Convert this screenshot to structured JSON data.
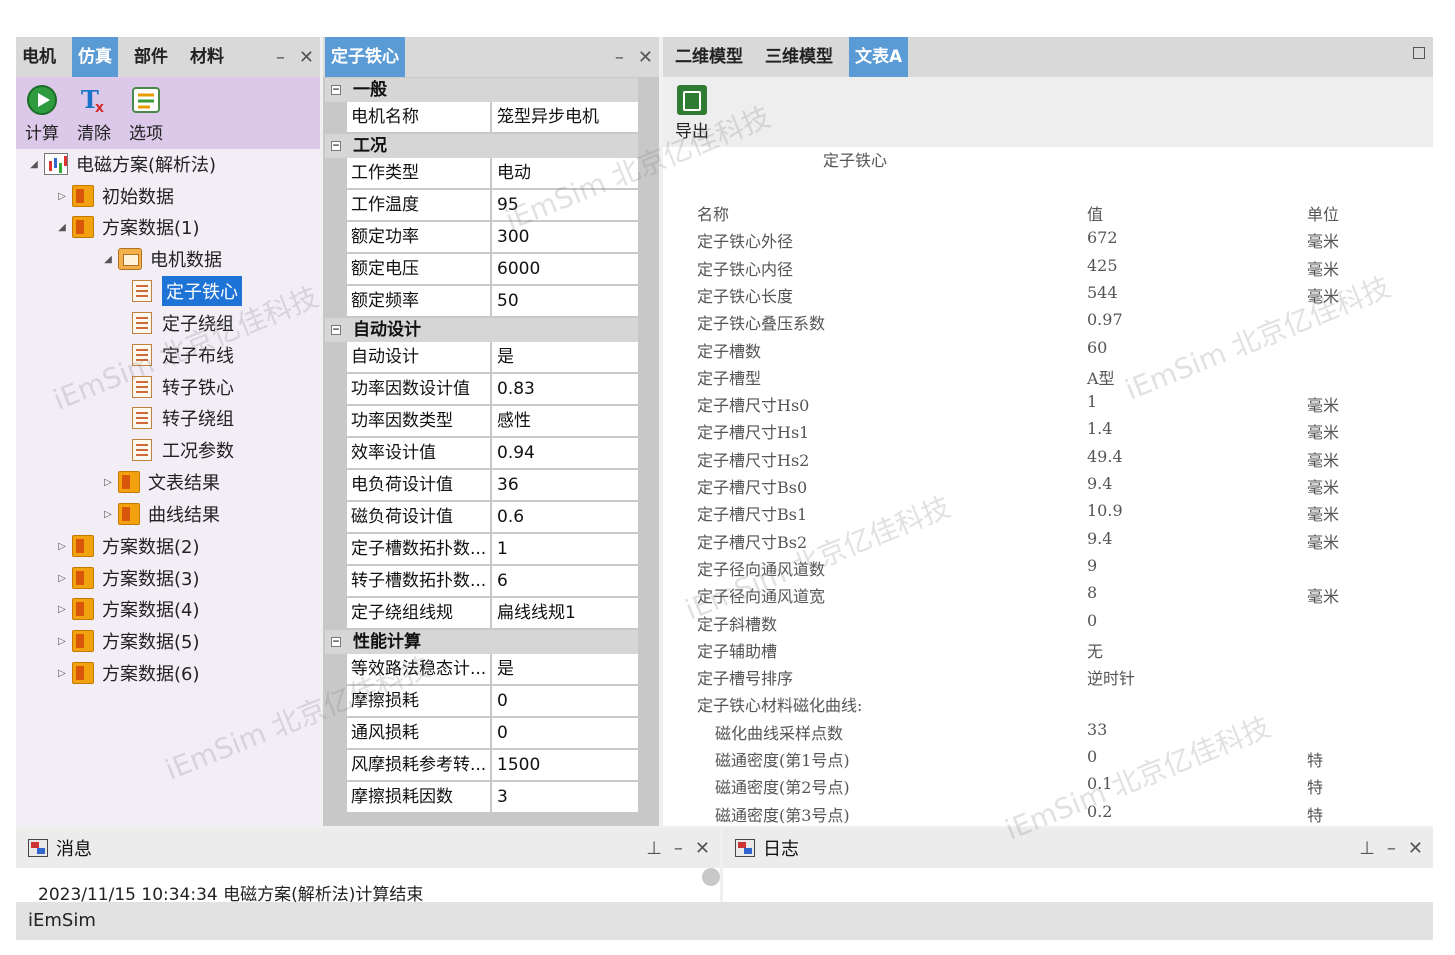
{
  "left": {
    "tabs": [
      "电机",
      "仿真",
      "部件",
      "材料"
    ],
    "active_tab": 1,
    "toolbar": {
      "calc": "计算",
      "clear": "清除",
      "options": "选项"
    },
    "tree": {
      "root": "电磁方案(解析法)",
      "init": "初始数据",
      "scheme1": "方案数据(1)",
      "motor_data": "电机数据",
      "leaf1": "定子铁心",
      "leaf2": "定子绕组",
      "leaf3": "定子布线",
      "leaf4": "转子铁心",
      "leaf5": "转子绕组",
      "leaf6": "工况参数",
      "text_result": "文表结果",
      "curve_result": "曲线结果",
      "scheme2": "方案数据(2)",
      "scheme3": "方案数据(3)",
      "scheme4": "方案数据(4)",
      "scheme5": "方案数据(5)",
      "scheme6": "方案数据(6)"
    }
  },
  "center": {
    "tab": "定子铁心",
    "categories": [
      "一般",
      "工况",
      "自动设计",
      "性能计算"
    ],
    "rows": [
      {
        "k": "电机名称",
        "v": "笼型异步电机"
      },
      {
        "k": "工作类型",
        "v": "电动"
      },
      {
        "k": "工作温度",
        "v": "95"
      },
      {
        "k": "额定功率",
        "v": "300"
      },
      {
        "k": "额定电压",
        "v": "6000"
      },
      {
        "k": "额定频率",
        "v": "50"
      },
      {
        "k": "自动设计",
        "v": "是"
      },
      {
        "k": "功率因数设计值",
        "v": "0.83"
      },
      {
        "k": "功率因数类型",
        "v": "感性"
      },
      {
        "k": "效率设计值",
        "v": "0.94"
      },
      {
        "k": "电负荷设计值",
        "v": "36"
      },
      {
        "k": "磁负荷设计值",
        "v": "0.6"
      },
      {
        "k": "定子槽数拓扑数...",
        "v": "1"
      },
      {
        "k": "转子槽数拓扑数...",
        "v": "6"
      },
      {
        "k": "定子绕组线规",
        "v": "扁线线规1"
      },
      {
        "k": "等效路法稳态计...",
        "v": "是"
      },
      {
        "k": "摩擦损耗",
        "v": "0"
      },
      {
        "k": "通风损耗",
        "v": "0"
      },
      {
        "k": "风摩损耗参考转...",
        "v": "1500"
      },
      {
        "k": "摩擦损耗因数",
        "v": "3"
      }
    ]
  },
  "right": {
    "tabs": [
      "二维模型",
      "三维模型",
      "文表A"
    ],
    "active_tab": 2,
    "export_label": "导出",
    "report_title": "定子铁心",
    "header": {
      "name": "名称",
      "value": "值",
      "unit": "单位"
    },
    "rows": [
      {
        "n": "定子铁心外径",
        "v": "672",
        "u": "毫米"
      },
      {
        "n": "定子铁心内径",
        "v": "425",
        "u": "毫米"
      },
      {
        "n": "定子铁心长度",
        "v": "544",
        "u": "毫米"
      },
      {
        "n": "定子铁心叠压系数",
        "v": "0.97",
        "u": ""
      },
      {
        "n": "定子槽数",
        "v": "60",
        "u": ""
      },
      {
        "n": "定子槽型",
        "v": "A型",
        "u": ""
      },
      {
        "n": "定子槽尺寸Hs0",
        "v": "1",
        "u": "毫米"
      },
      {
        "n": "定子槽尺寸Hs1",
        "v": "1.4",
        "u": "毫米"
      },
      {
        "n": "定子槽尺寸Hs2",
        "v": "49.4",
        "u": "毫米"
      },
      {
        "n": "定子槽尺寸Bs0",
        "v": "9.4",
        "u": "毫米"
      },
      {
        "n": "定子槽尺寸Bs1",
        "v": "10.9",
        "u": "毫米"
      },
      {
        "n": "定子槽尺寸Bs2",
        "v": "9.4",
        "u": "毫米"
      },
      {
        "n": "定子径向通风道数",
        "v": "9",
        "u": ""
      },
      {
        "n": "定子径向通风道宽",
        "v": "8",
        "u": "毫米"
      },
      {
        "n": "定子斜槽数",
        "v": "0",
        "u": ""
      },
      {
        "n": "定子辅助槽",
        "v": "无",
        "u": ""
      },
      {
        "n": "定子槽号排序",
        "v": "逆时针",
        "u": ""
      },
      {
        "n": "定子铁心材料磁化曲线:",
        "v": "",
        "u": ""
      },
      {
        "n": "磁化曲线采样点数",
        "v": "33",
        "u": "",
        "indent": true
      },
      {
        "n": "磁通密度(第1号点)",
        "v": "0",
        "u": "特",
        "indent": true
      },
      {
        "n": "磁通密度(第2号点)",
        "v": "0.1",
        "u": "特",
        "indent": true
      },
      {
        "n": "磁通密度(第3号点)",
        "v": "0.2",
        "u": "特",
        "indent": true
      }
    ]
  },
  "messages": {
    "title": "消息",
    "text": "2023/11/15 10:34:34  电磁方案(解析法)计算结束"
  },
  "log": {
    "title": "日志"
  },
  "status": "iEmSim",
  "watermark": "iEmSim 北京亿佳科技"
}
